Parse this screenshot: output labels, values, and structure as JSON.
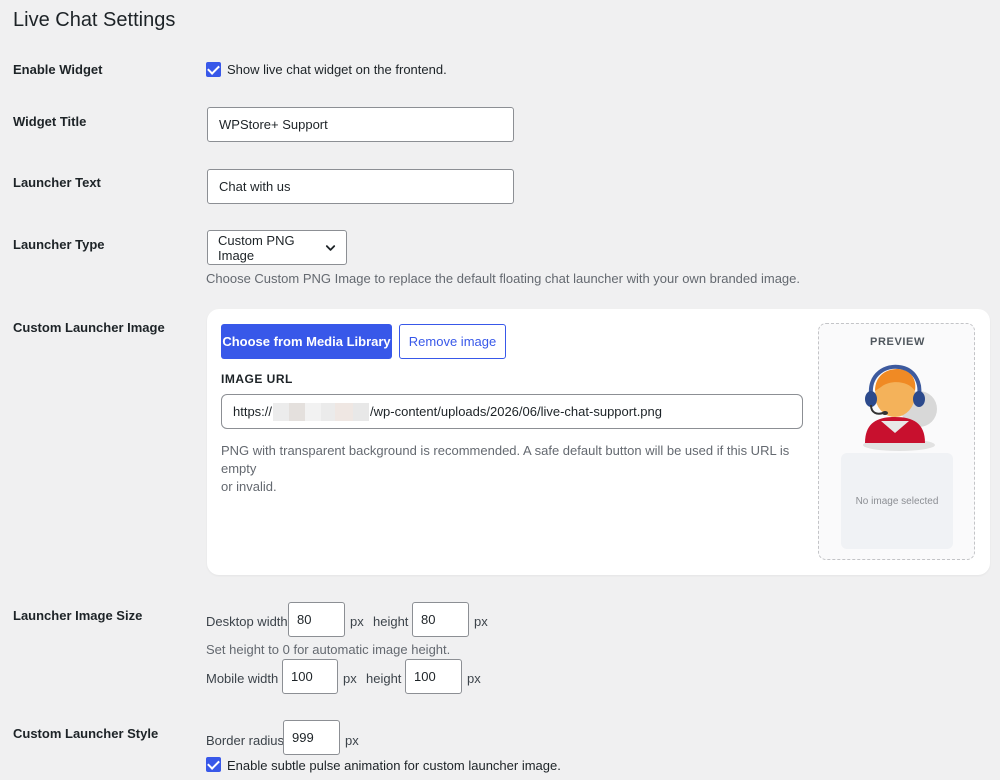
{
  "page": {
    "title": "Live Chat Settings"
  },
  "enable_widget": {
    "label": "Enable Widget",
    "checkbox_label": "Show live chat widget on the frontend.",
    "checked": true
  },
  "widget_title": {
    "label": "Widget Title",
    "value": "WPStore+ Support"
  },
  "launcher_text": {
    "label": "Launcher Text",
    "value": "Chat with us"
  },
  "launcher_type": {
    "label": "Launcher Type",
    "selected": "Custom PNG Image",
    "description": "Choose Custom PNG Image to replace the default floating chat launcher with your own branded image."
  },
  "custom_image": {
    "label": "Custom Launcher Image",
    "choose_button": "Choose from Media Library",
    "remove_button": "Remove image",
    "url_heading": "IMAGE URL",
    "url_prefix": "https://",
    "url_suffix": "/wp-content/uploads/2026/06/live-chat-support.png",
    "help_line1": "PNG with transparent background is recommended. A safe default button will be used if this URL is empty",
    "help_line2": "or invalid.",
    "preview_title": "PREVIEW",
    "preview_empty": "No image selected",
    "preview_icon": "support-agent-headset-icon"
  },
  "image_size": {
    "label": "Launcher Image Size",
    "desktop_label": "Desktop width",
    "desktop_width": "80",
    "desktop_height": "80",
    "height_label": "height",
    "unit": "px",
    "height_hint": "Set height to 0 for automatic image height.",
    "mobile_label": "Mobile width",
    "mobile_width": "100",
    "mobile_height": "100"
  },
  "launcher_style": {
    "label": "Custom Launcher Style",
    "radius_label": "Border radius",
    "radius_value": "999",
    "unit": "px",
    "pulse_label": "Enable subtle pulse animation for custom launcher image.",
    "pulse_checked": true
  },
  "colors": {
    "accent": "#3858e9",
    "background": "#f0f0f1"
  }
}
